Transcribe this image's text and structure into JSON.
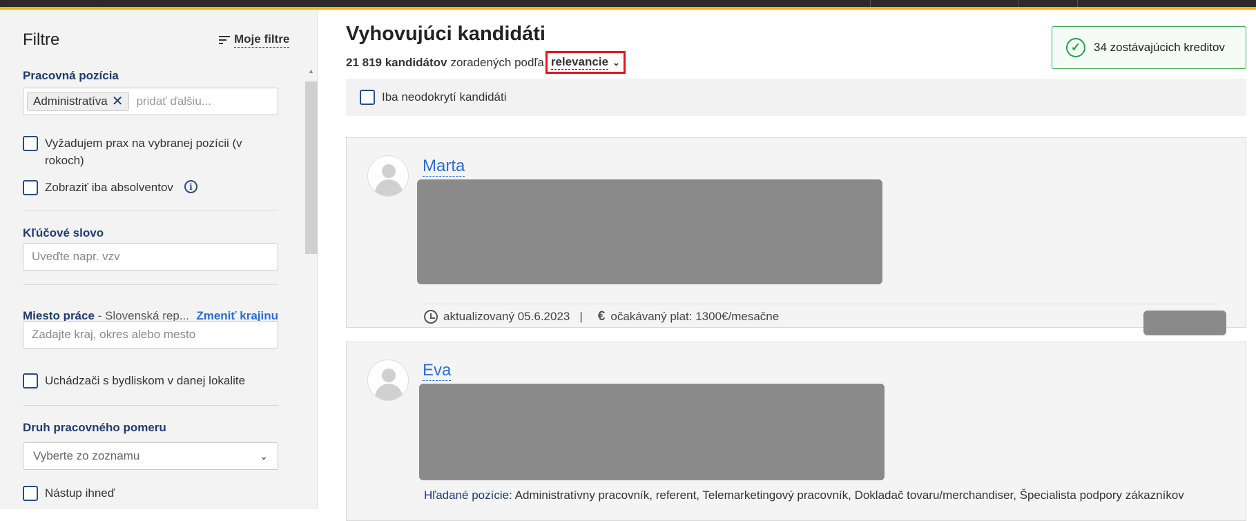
{
  "sidebar": {
    "title": "Filtre",
    "my_filters": "Moje filtre",
    "position": {
      "label": "Pracovná pozícia",
      "tag": "Administratíva",
      "placeholder": "pridať ďalšiu..."
    },
    "require_experience": "Vyžadujem prax na vybranej pozícii (v rokoch)",
    "graduates_only": "Zobraziť iba absolventov",
    "keyword": {
      "label": "Kľúčové slovo",
      "placeholder": "Uveďte napr. vzv"
    },
    "location": {
      "label": "Miesto práce",
      "value": "- Slovenská rep...",
      "change": "Zmeniť krajinu",
      "placeholder": "Zadajte kraj, okres alebo mesto"
    },
    "residence": "Uchádzači s bydliskom v danej lokalite",
    "employment_type": {
      "label": "Druh pracovného pomeru",
      "placeholder": "Vyberte zo zoznamu"
    },
    "start_now": "Nástup ihneď"
  },
  "main": {
    "title": "Vyhovujúci kandidáti",
    "count": "21 819 kandidátov",
    "sorted_by": "zoradených podľa",
    "sort_value": "relevancie",
    "credits": "34 zostávajúcich kreditov",
    "only_unrevealed": "Iba neodokrytí kandidáti",
    "candidates": [
      {
        "name": "Marta",
        "updated": "aktualizovaný 05.6.2023",
        "separator": "|",
        "salary": "očakávaný plat: 1300€/mesačne"
      },
      {
        "name": "Eva",
        "positions_label": "Hľadané pozície:",
        "positions": "Administratívny pracovník, referent, Telemarketingový pracovník, Dokladač tovaru/merchandiser, Špecialista podpory zákazníkov"
      }
    ]
  },
  "colors": {
    "accent_bar": "#f2b705",
    "link_blue": "#2a6dd4",
    "label_navy": "#1f3b6f",
    "highlight_red": "#e8121b",
    "success_green": "#27a14a"
  }
}
